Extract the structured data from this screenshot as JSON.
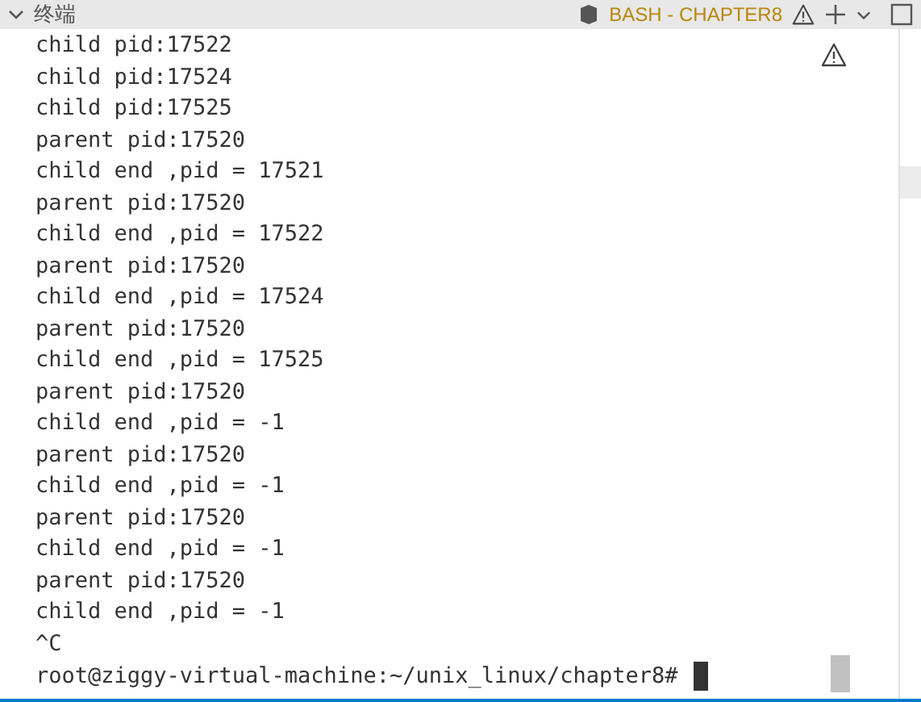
{
  "panel": {
    "title": "终端",
    "terminal_name": "BASH - CHAPTER8"
  },
  "terminal": {
    "lines": [
      "child pid:17522",
      "child pid:17524",
      "child pid:17525",
      "parent pid:17520",
      "child end ,pid = 17521",
      "parent pid:17520",
      "child end ,pid = 17522",
      "parent pid:17520",
      "child end ,pid = 17524",
      "parent pid:17520",
      "child end ,pid = 17525",
      "parent pid:17520",
      "child end ,pid = -1",
      "parent pid:17520",
      "child end ,pid = -1",
      "parent pid:17520",
      "child end ,pid = -1",
      "parent pid:17520",
      "child end ,pid = -1",
      "^C"
    ],
    "prompt": "root@ziggy-virtual-machine:~/unix_linux/chapter8#"
  }
}
